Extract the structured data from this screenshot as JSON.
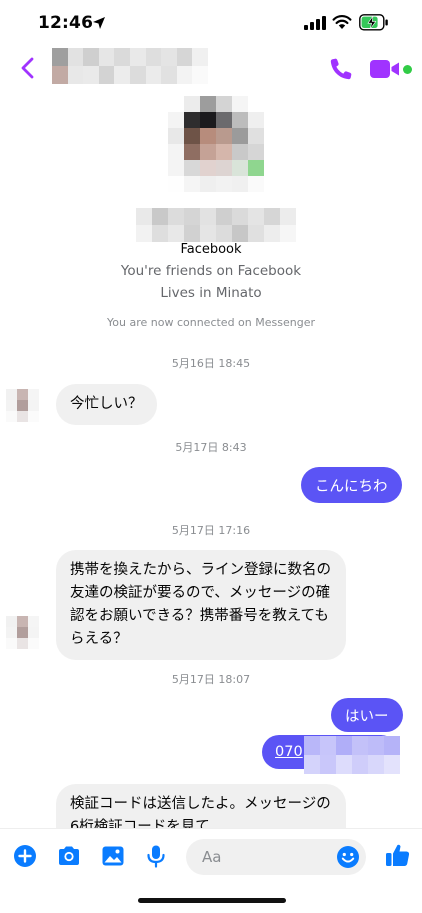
{
  "status_bar": {
    "time": "12:46",
    "battery_color": "#34c759"
  },
  "header": {
    "accent": "#a033ff",
    "online_color": "#31cc46"
  },
  "profile": {
    "line1": "Facebook",
    "line2": "You're friends on Facebook",
    "line3": "Lives in Minato",
    "connected": "You are now connected on Messenger"
  },
  "messages": [
    {
      "timestamp": "5月16日 18:45",
      "direction": "in",
      "lines": [
        "今忙しい？"
      ]
    },
    {
      "timestamp": "5月17日 8:43",
      "direction": "out",
      "lines": [
        "こんにちわ"
      ]
    },
    {
      "timestamp": "5月17日 17:16",
      "direction": "in",
      "lines": [
        "携帯を換えたから、ライン登録に数名の",
        "友達の検証が要るので、メッセージの確",
        "認をお願いできる？携帯番号を教えても",
        "らえる？"
      ]
    },
    {
      "timestamp": "5月17日 18:07",
      "direction": "out",
      "lines": [
        "はいー"
      ]
    },
    {
      "direction": "out",
      "lines": [
        "070"
      ]
    },
    {
      "direction": "in",
      "lines": [
        "検証コードは送信したよ。メッセージの",
        "6桁検証コードを見て"
      ]
    }
  ],
  "composer": {
    "placeholder": "Aa",
    "accent": "#0a7cff",
    "outgoing_bubble": "#5b54f5"
  }
}
